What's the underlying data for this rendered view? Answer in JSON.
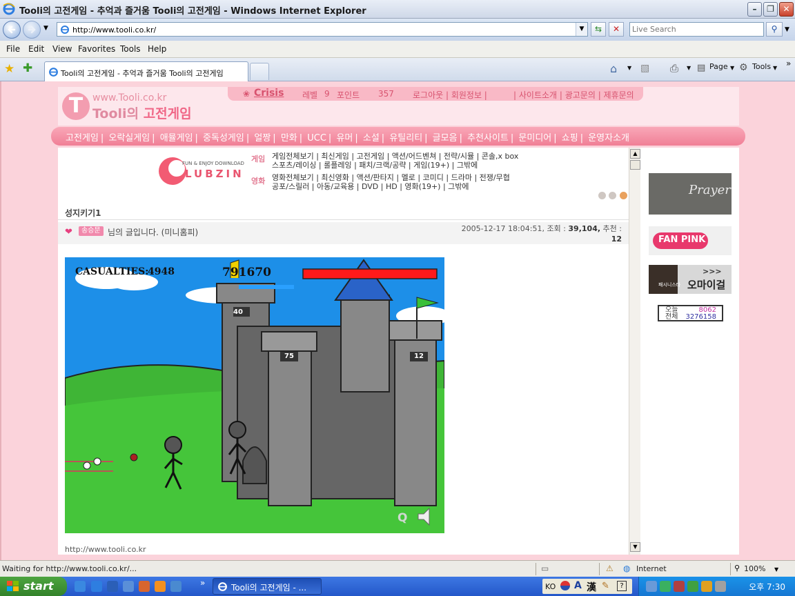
{
  "window": {
    "title": "Tooli의 고전게임 - 추억과 즐거움 Tooli의 고전게임 - Windows Internet Explorer"
  },
  "address": {
    "url": "http://www.tooli.co.kr/",
    "search_placeholder": "Live Search"
  },
  "menu": [
    "File",
    "Edit",
    "View",
    "Favorites",
    "Tools",
    "Help"
  ],
  "tab": {
    "label": "Tooli의 고전게임 - 추억과 즐거움 Tooli의 고전게임"
  },
  "commandbar": {
    "page": "Page",
    "tools": "Tools"
  },
  "site": {
    "logo_url": "www.Tooli.co.kr",
    "logo_name_prefix": "Tooli의",
    "logo_name_suffix": "고전게임",
    "user": "Crisis",
    "level_label": "레벨",
    "level": "9",
    "points_label": "포인트",
    "points": "357",
    "account_links": "로그아웃 | 회원정보 |",
    "site_links": "| 사이트소개 | 광고문의 | 제휴문의",
    "nav": [
      "고전게임",
      "오락실게임",
      "애뮬게임",
      "중독성게임",
      "얼짱",
      "만화",
      "UCC",
      "유머",
      "소설",
      "유틸리티",
      "글모음",
      "추천사이트",
      "문미디어",
      "쇼핑",
      "운영자소개"
    ],
    "lubzin": {
      "tagline": "FUN & ENJOY DOWNLOAD",
      "name": "LUBZIN",
      "game_label": "게임",
      "game_line1": "게임전체보기 | 최신게임 | 고전게임 | 액션/어드벤쳐 | 전략/시뮬 | 콘솔,x box",
      "game_line2": "스포츠/레이싱 | 롤플레잉 | 패치/크랙/공략 | 게임(19+) | 그밖에",
      "movie_label": "영화",
      "movie_line1": "영화전체보기 | 최신영화 | 액션/판타지 | 멜로 | 코미디 | 드라마 | 전쟁/무협",
      "movie_line2": "공포/스릴러 | 아동/교육용 | DVD | HD | 영화(19+) | 그밖에"
    },
    "post": {
      "title": "성지키기1",
      "author": "송승문",
      "intro": "님의 글입니다. (미니홈피)",
      "date": "2005-12-17 18:04:51,",
      "views_label": "조회 :",
      "views": "39,104,",
      "recommend_label": "추천 :",
      "recommend": "12",
      "url": "http://www.tooli.co.kr"
    },
    "game": {
      "casualties_label": "CASUALTIES:",
      "casualties": "4948",
      "score": "791670",
      "tower_left": "40",
      "tower_mid": "75",
      "tower_right": "12",
      "hud_q": "Q"
    },
    "sidebar": {
      "banner1": "Prayer",
      "banner2": "FAN PINK",
      "banner3_small": "패시니스타",
      "banner3": "오마이걸",
      "banner3_arrows": ">>>",
      "today_label": "오늘",
      "today": "8062",
      "total_label": "전체",
      "total": "3276158"
    }
  },
  "statusbar": {
    "text": "Waiting for http://www.tooli.co.kr/...",
    "zone": "Internet",
    "zoom": "100%"
  },
  "taskbar": {
    "start": "start",
    "task": "Tooli의 고전게임 - ...",
    "lang": "KO",
    "hanja": "漢",
    "letter_a": "A",
    "chevron": "»",
    "clock": "오후 7:30"
  },
  "colors": {
    "pink_bg": "#fbd3db",
    "nav_pink": "#f07f96",
    "accent_text": "#d8536f"
  }
}
